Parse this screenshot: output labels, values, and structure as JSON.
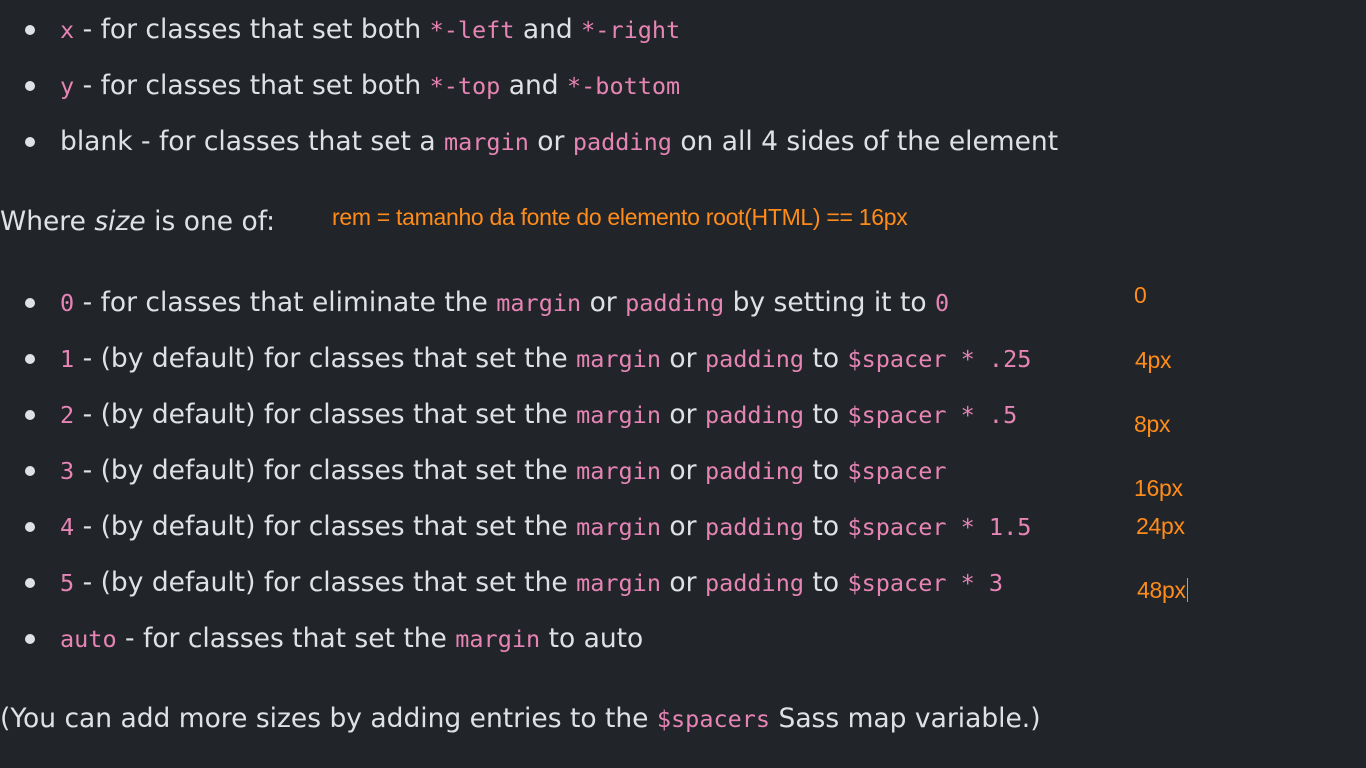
{
  "dimension_items": [
    {
      "code": "x",
      "text_before": " - for classes that set both ",
      "code_a": "*-left",
      "mid": " and ",
      "code_b": "*-right"
    },
    {
      "code": "y",
      "text_before": " - for classes that set both ",
      "code_a": "*-top",
      "mid": " and ",
      "code_b": "*-bottom"
    }
  ],
  "blank_item": {
    "lead": "blank - for classes that set a ",
    "code_a": "margin",
    "mid": " or ",
    "code_b": "padding",
    "tail": " on all 4 sides of the element"
  },
  "size_heading": {
    "before": "Where ",
    "em": "size",
    "after": " is one of:"
  },
  "rem_note": "rem = tamanho da fonte do elemento root(HTML) == 16px",
  "zero_item": {
    "code": "0",
    "text": " - for classes that eliminate the ",
    "code_a": "margin",
    "mid": " or ",
    "code_b": "padding",
    "after": " by setting it to ",
    "code_c": "0"
  },
  "size_items": [
    {
      "num": "1",
      "text": " - (by default) for classes that set the ",
      "code_a": "margin",
      "mid": " or ",
      "code_b": "padding",
      "to": " to ",
      "value": "$spacer * .25"
    },
    {
      "num": "2",
      "text": " - (by default) for classes that set the ",
      "code_a": "margin",
      "mid": " or ",
      "code_b": "padding",
      "to": " to ",
      "value": "$spacer * .5"
    },
    {
      "num": "3",
      "text": " - (by default) for classes that set the ",
      "code_a": "margin",
      "mid": " or ",
      "code_b": "padding",
      "to": " to ",
      "value": "$spacer"
    },
    {
      "num": "4",
      "text": " - (by default) for classes that set the ",
      "code_a": "margin",
      "mid": " or ",
      "code_b": "padding",
      "to": " to ",
      "value": "$spacer * 1.5"
    },
    {
      "num": "5",
      "text": " - (by default) for classes that set the ",
      "code_a": "margin",
      "mid": " or ",
      "code_b": "padding",
      "to": " to ",
      "value": "$spacer * 3"
    }
  ],
  "auto_item": {
    "code": "auto",
    "text": " - for classes that set the ",
    "code_a": "margin",
    "after": " to auto"
  },
  "px_notes": [
    "0",
    "4px",
    "8px",
    "16px",
    "24px",
    "48px"
  ],
  "footer": {
    "before": "(You can add more sizes by adding entries to the ",
    "code": "$spacers",
    "after": " Sass map variable.)"
  },
  "colors": {
    "background": "#212529",
    "text": "#dee2e6",
    "code": "#e685b5",
    "annotation": "#ff8c1a"
  }
}
